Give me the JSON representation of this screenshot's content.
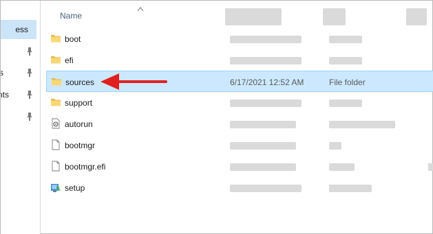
{
  "nav": {
    "items": [
      {
        "label": "ess",
        "selected": true,
        "pinned": false
      },
      {
        "label": "",
        "selected": false,
        "pinned": true
      },
      {
        "label": "ds",
        "selected": false,
        "pinned": true
      },
      {
        "label": "nts",
        "selected": false,
        "pinned": true
      },
      {
        "label": "",
        "selected": false,
        "pinned": true
      }
    ]
  },
  "header": {
    "name_label": "Name",
    "sort": "ascending"
  },
  "files": [
    {
      "name": "boot",
      "icon": "folder-icon",
      "date": "",
      "type": ""
    },
    {
      "name": "efi",
      "icon": "folder-icon",
      "date": "",
      "type": ""
    },
    {
      "name": "sources",
      "icon": "folder-icon",
      "date": "6/17/2021 12:52 AM",
      "type": "File folder",
      "selected": true
    },
    {
      "name": "support",
      "icon": "folder-icon",
      "date": "",
      "type": ""
    },
    {
      "name": "autorun",
      "icon": "settings-file-icon",
      "date": "",
      "type": ""
    },
    {
      "name": "bootmgr",
      "icon": "file-icon",
      "date": "",
      "type": ""
    },
    {
      "name": "bootmgr.efi",
      "icon": "file-icon",
      "date": "",
      "type": ""
    },
    {
      "name": "setup",
      "icon": "setup-app-icon",
      "date": "",
      "type": ""
    }
  ],
  "annotation": {
    "arrow_color": "#e0201f"
  },
  "colors": {
    "selection": "#cce8ff",
    "selection_border": "#99d1ff",
    "folder": "#f8d775",
    "redacted": "#dadada"
  }
}
